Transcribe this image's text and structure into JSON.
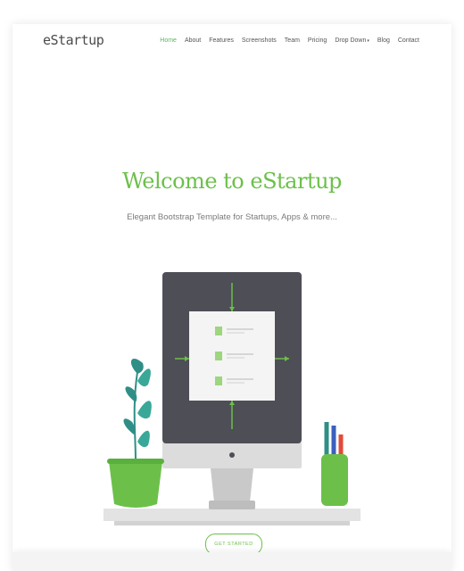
{
  "brand": {
    "logo_text": "eStartup"
  },
  "nav": {
    "items": [
      {
        "label": "Home",
        "active": true
      },
      {
        "label": "About"
      },
      {
        "label": "Features"
      },
      {
        "label": "Screenshots"
      },
      {
        "label": "Team"
      },
      {
        "label": "Pricing"
      },
      {
        "label": "Drop Down"
      },
      {
        "label": "Blog"
      },
      {
        "label": "Contact"
      }
    ],
    "dropdown_caret": "▾"
  },
  "hero": {
    "title": "Welcome to eStartup",
    "subtitle": "Elegant Bootstrap Template for Startups, Apps & more...",
    "cta_label": "GET STARTED"
  },
  "colors": {
    "accent": "#6cc04a",
    "monitor_dark": "#4d4e56",
    "monitor_stand": "#c9c9c9",
    "desk": "#e3e3e3",
    "plant_leaf": "#2f8f86",
    "pot": "#6cc04a"
  },
  "icons": {
    "illustration": "computer-desk-illustration"
  }
}
